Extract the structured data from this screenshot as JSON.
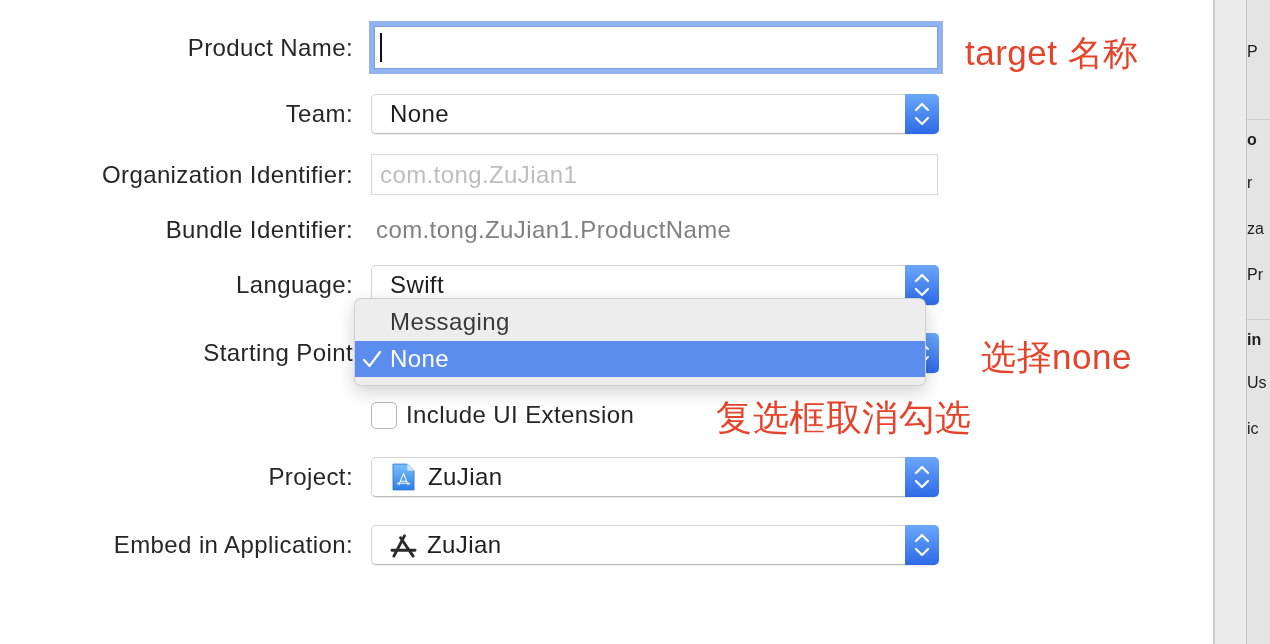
{
  "form": {
    "fields": [
      {
        "kind": "text",
        "label": "Product Name:",
        "focused": true
      },
      {
        "kind": "popup",
        "label": "Team:",
        "value": "None"
      },
      {
        "kind": "text",
        "label": "Organization Identifier:",
        "placeholder": "com.tong.ZuJian1",
        "focused": false
      },
      {
        "kind": "static",
        "label": "Bundle Identifier:",
        "value": "com.tong.ZuJian1.ProductName"
      },
      {
        "kind": "popup",
        "label": "Language:",
        "value": "Swift"
      },
      {
        "kind": "popup",
        "label": "Starting Point",
        "menu": {
          "items": [
            {
              "label": "Messaging",
              "selected": false
            },
            {
              "label": "None",
              "selected": true
            }
          ]
        }
      },
      {
        "kind": "checkbox",
        "label": "Include UI Extension",
        "checked": false
      },
      {
        "kind": "project",
        "label": "Project:",
        "value": "ZuJian"
      },
      {
        "kind": "application",
        "label": "Embed in Application:",
        "value": "ZuJian"
      }
    ]
  },
  "annotations": [
    {
      "text": "target 名称"
    },
    {
      "text": "选择none"
    },
    {
      "text": "复选框取消勾选"
    }
  ],
  "side_panel": {
    "groups": [
      {
        "items": [
          "P"
        ]
      },
      {
        "title": "o",
        "items": [
          "r",
          "za",
          "Pr"
        ]
      },
      {
        "title": "in",
        "items": [
          "Us",
          "ic"
        ]
      }
    ]
  }
}
